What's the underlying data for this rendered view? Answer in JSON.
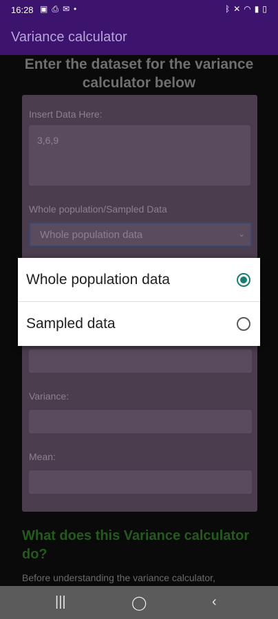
{
  "status_bar": {
    "time": "16:28",
    "icons": [
      "gallery-icon",
      "printer-icon",
      "message-icon",
      "dot-icon",
      "bluetooth-icon",
      "mute-icon",
      "wifi-icon",
      "signal-icon",
      "battery-icon"
    ]
  },
  "app_bar": {
    "title": "Variance calculator"
  },
  "content": {
    "heading": "Enter the dataset for the variance calculator below",
    "insert_label": "Insert Data Here:",
    "insert_value": "3,6,9",
    "population_label": "Whole population/Sampled Data",
    "select_value": "Whole population data",
    "variance_label": "Variance:",
    "mean_label": "Mean:",
    "section_heading": "What does this Variance calculator do?",
    "section_text": "Before understanding the variance calculator,"
  },
  "dialog": {
    "options": [
      {
        "label": "Whole population data",
        "selected": true
      },
      {
        "label": "Sampled data",
        "selected": false
      }
    ]
  },
  "colors": {
    "app_bar": "#3c146e",
    "radio_selected": "#14806f",
    "section_heading": "#245a1c"
  }
}
